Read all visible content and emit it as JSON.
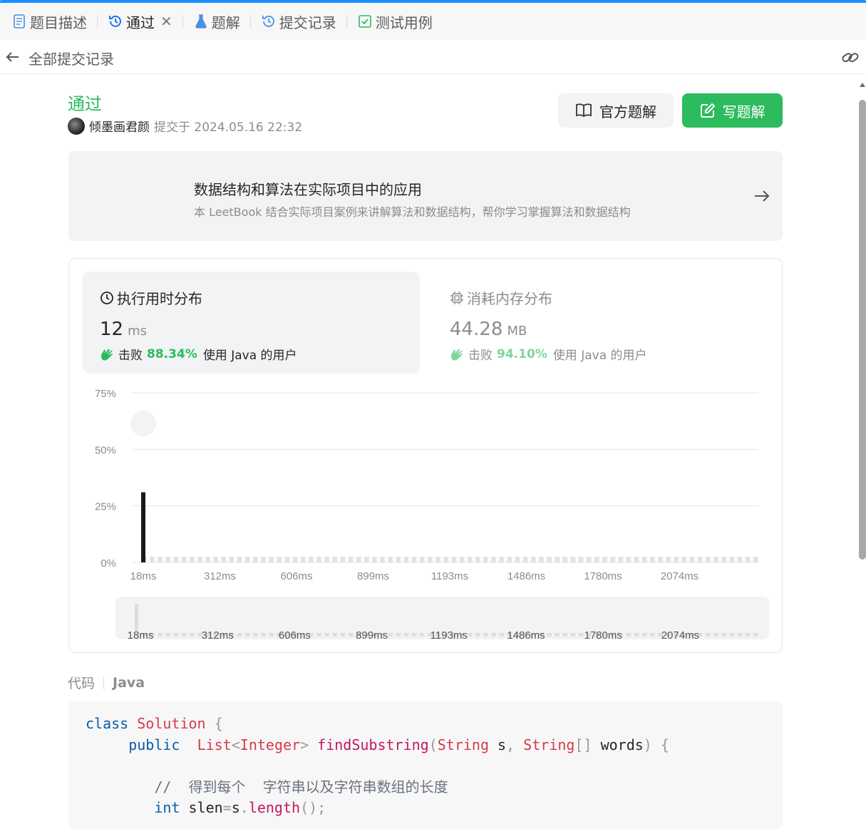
{
  "tabs": [
    {
      "label": "题目描述",
      "icon": "document-icon"
    },
    {
      "label": "通过",
      "icon": "history-icon"
    },
    {
      "label": "题解",
      "icon": "flask-icon"
    },
    {
      "label": "提交记录",
      "icon": "history-icon"
    },
    {
      "label": "测试用例",
      "icon": "checkbox-icon"
    }
  ],
  "subbar": {
    "title": "全部提交记录"
  },
  "submission": {
    "status": "通过",
    "user": "倾墨画君颜",
    "submitted_at": "提交于 2024.05.16 22:32"
  },
  "buttons": {
    "official_solution": "官方题解",
    "write_solution": "写题解"
  },
  "promo": {
    "title": "数据结构和算法在实际项目中的应用",
    "description": "本 LeetBook 结合实际项目案例来讲解算法和数据结构，帮你学习掌握算法和数据结构"
  },
  "runtime": {
    "label": "执行用时分布",
    "value": "12",
    "unit": "ms",
    "beats_prefix": "击败",
    "beats_pct": "88.34%",
    "beats_suffix": "使用 Java 的用户"
  },
  "memory": {
    "label": "消耗内存分布",
    "value": "44.28",
    "unit": "MB",
    "beats_prefix": "击败",
    "beats_pct": "94.10%",
    "beats_suffix": "使用 Java 的用户"
  },
  "chart_data": {
    "type": "bar",
    "y_ticks": [
      "75%",
      "50%",
      "25%",
      "0%"
    ],
    "ylim": [
      0,
      75
    ],
    "x_ticks": [
      "18ms",
      "312ms",
      "606ms",
      "899ms",
      "1193ms",
      "1486ms",
      "1780ms",
      "2074ms"
    ],
    "highlight": {
      "x": "18ms",
      "value": 31
    },
    "minor_bar_count": 78,
    "minor_bar_value": 0.5
  },
  "code": {
    "label": "代码",
    "language": "Java"
  },
  "colors": {
    "accent": "#2cbb5d",
    "brand_blue": "#1a90ff"
  }
}
